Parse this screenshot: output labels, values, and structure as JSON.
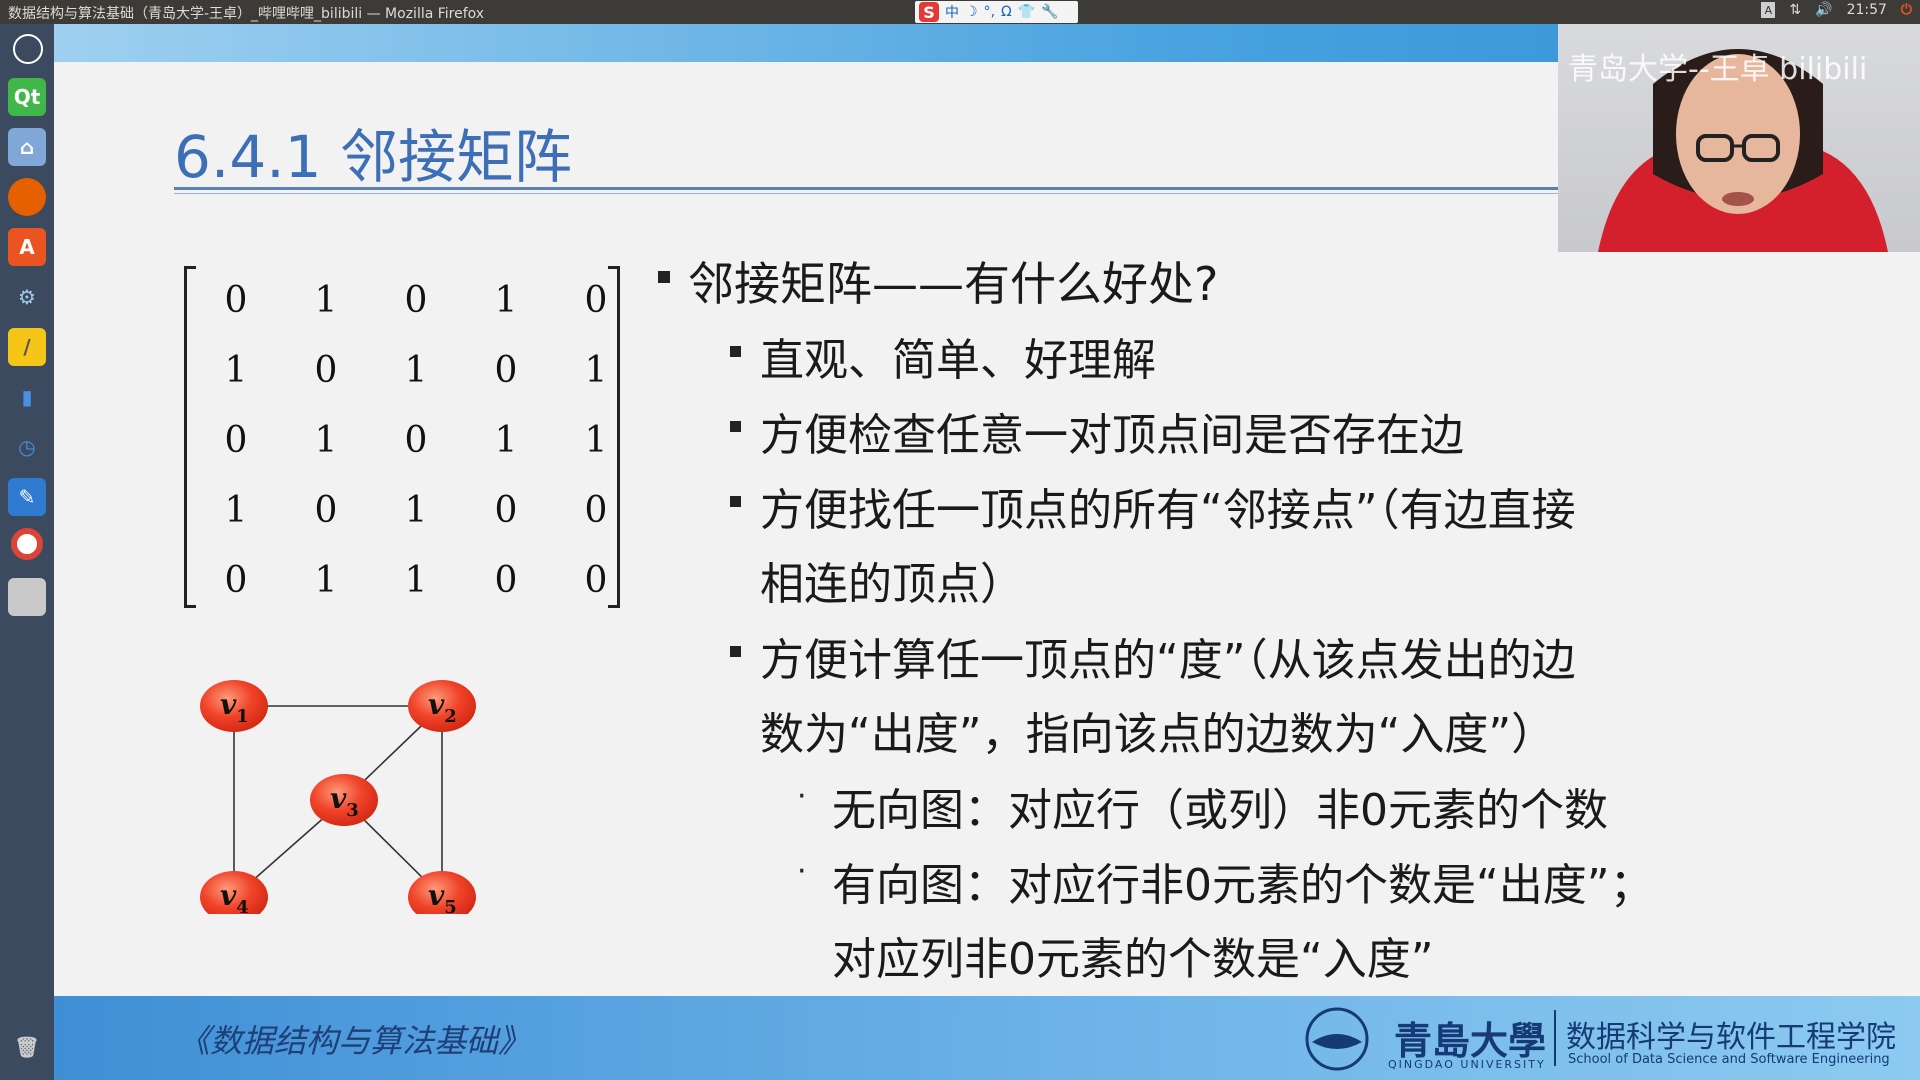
{
  "window": {
    "title": "数据结构与算法基础（青岛大学-王卓）_哔哩哔哩_bilibili — Mozilla Firefox"
  },
  "system_tray": {
    "ime": [
      "中",
      "☽",
      "°,",
      "Ω",
      "👕",
      "🔧"
    ],
    "ime_logo": "S",
    "keyboard": "A",
    "time": "21:57"
  },
  "launcher": {
    "items": [
      "ubuntu-icon",
      "qt-icon",
      "files-icon",
      "firefox-icon",
      "software-center-icon",
      "settings-icon",
      "notes-icon",
      "monitor-icon",
      "clock-icon",
      "editor-icon",
      "chrome-icon",
      "drive-icon",
      "trash-icon"
    ]
  },
  "slide": {
    "heading": "6.4.1 邻接矩阵",
    "matrix": [
      [
        "0",
        "1",
        "0",
        "1",
        "0"
      ],
      [
        "1",
        "0",
        "1",
        "0",
        "1"
      ],
      [
        "0",
        "1",
        "0",
        "1",
        "1"
      ],
      [
        "1",
        "0",
        "1",
        "0",
        "0"
      ],
      [
        "0",
        "1",
        "1",
        "0",
        "0"
      ]
    ],
    "graph": {
      "nodes": [
        {
          "label": "v",
          "sub": "1"
        },
        {
          "label": "v",
          "sub": "2"
        },
        {
          "label": "v",
          "sub": "3"
        },
        {
          "label": "v",
          "sub": "4"
        },
        {
          "label": "v",
          "sub": "5"
        }
      ],
      "edges": [
        [
          "1",
          "2"
        ],
        [
          "1",
          "4"
        ],
        [
          "2",
          "3"
        ],
        [
          "2",
          "5"
        ],
        [
          "3",
          "4"
        ],
        [
          "3",
          "5"
        ]
      ]
    },
    "bullets": {
      "main": "邻接矩阵——有什么好处?",
      "sub1": "直观、简单、好理解",
      "sub2": "方便检查任意一对顶点间是否存在边",
      "sub3_line1": "方便找任一顶点的所有“邻接点”（有边直接",
      "sub3_line2": "相连的顶点）",
      "sub4_line1": "方便计算任一顶点的“度”（从该点发出的边",
      "sub4_line2": "数为“出度”，指向该点的边数为“入度”）",
      "sub4a": "无向图：对应行（或列）非0元素的个数",
      "sub4b_line1": "有向图：对应行非0元素的个数是“出度”；",
      "sub4b_line2": "对应列非0元素的个数是“入度”"
    },
    "footer": {
      "course": "《数据结构与算法基础》",
      "university": "青島大學",
      "university_en": "QINGDAO UNIVERSITY",
      "school": "数据科学与软件工程学院",
      "school_en": "School of Data Science and Software Engineering"
    }
  },
  "webcam": {
    "watermark": "青岛大学--王卓 bilibili"
  },
  "colors": {
    "heading": "#3d6fb6",
    "node_fill": "#f0442a",
    "band": "#4aa3df"
  }
}
